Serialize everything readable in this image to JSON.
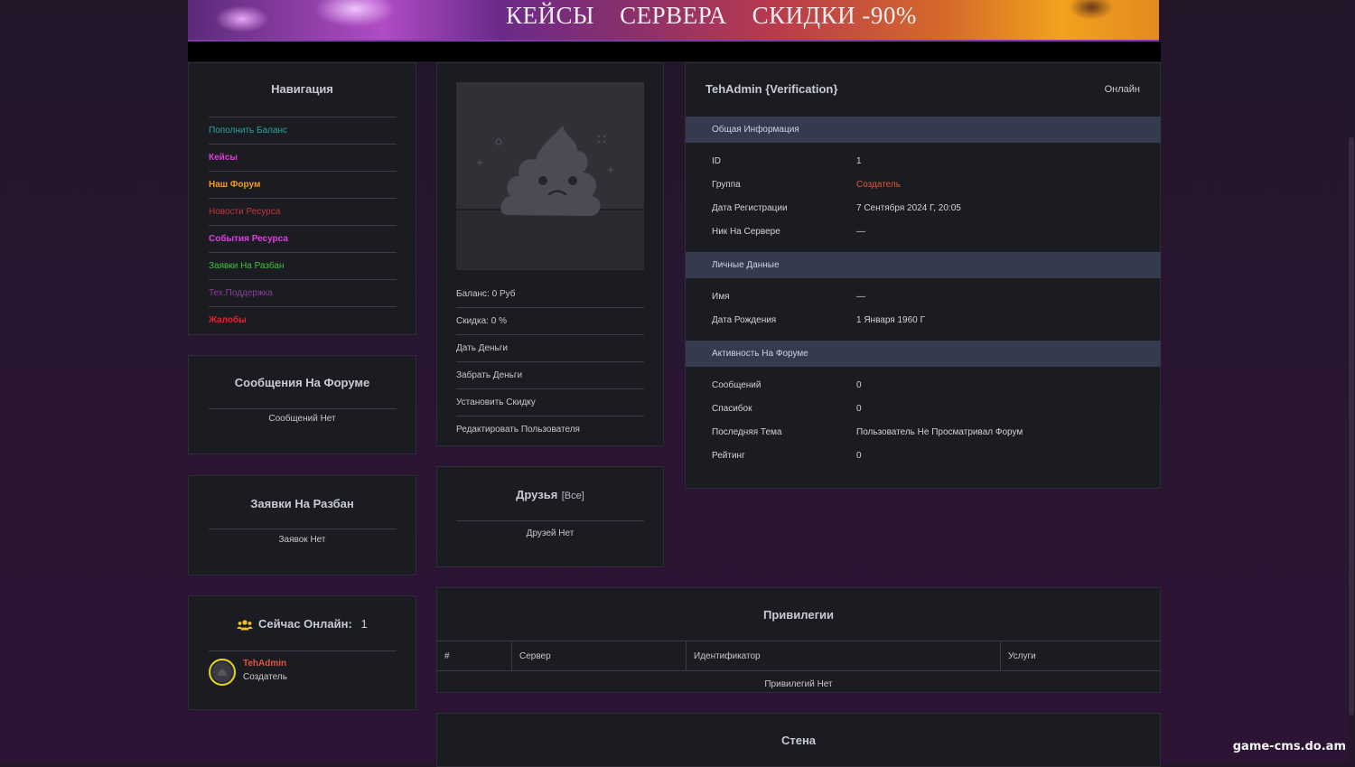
{
  "banner": {
    "items": [
      "КЕЙСЫ",
      "СЕРВЕРА",
      "СКИДКИ -90%"
    ]
  },
  "colors": {
    "accent_bar": "#353a4f",
    "panel_bg": "#1b1c22",
    "page_bg": "#231629"
  },
  "navigation": {
    "title": "Навигация",
    "items": [
      {
        "label": "Пополнить Баланс",
        "color": "#2ea3a3"
      },
      {
        "label": "Кейсы",
        "color": "#e03bd8"
      },
      {
        "label": "Наш Форум",
        "color": "#f39a1a"
      },
      {
        "label": "Новости Ресурса",
        "color": "#c2343d"
      },
      {
        "label": "События Ресурса",
        "color": "#e33be3"
      },
      {
        "label": "Заявки На Разбан",
        "color": "#3cc23c"
      },
      {
        "label": "Тех.Поддержка",
        "color": "#8a3e9c"
      },
      {
        "label": "Жалобы",
        "color": "#e0232d"
      }
    ]
  },
  "forum_messages": {
    "title": "Сообщения На Форуме",
    "empty": "Сообщений Нет"
  },
  "unban_requests": {
    "title": "Заявки На Разбан",
    "empty": "Заявок Нет"
  },
  "online": {
    "icon": "users-icon",
    "title": "Сейчас Онлайн:",
    "count": "1",
    "user": {
      "name": "TehAdmin",
      "role": "Создатель",
      "name_color": "#e0553a"
    }
  },
  "profile": {
    "avatar_icon": "poop-icon",
    "stats": [
      "Баланс: 0 Руб",
      "Скидка: 0 %",
      "Дать Деньги",
      "Забрать Деньги",
      "Установить Скидку",
      "Редактировать Пользователя"
    ]
  },
  "friends": {
    "title": "Друзья",
    "all_link": "[Все]",
    "empty": "Друзей Нет"
  },
  "user": {
    "name": "TehAdmin {Verification}",
    "status": "Онлайн",
    "general": {
      "title": "Общая Информация",
      "rows": [
        {
          "label": "ID",
          "value": "1"
        },
        {
          "label": "Группа",
          "value": "Создатель"
        },
        {
          "label": "Дата Регистрации",
          "value": "7 Сентября 2024 Г, 20:05"
        },
        {
          "label": "Ник На Сервере",
          "value": "—"
        }
      ]
    },
    "personal": {
      "title": "Личные Данные",
      "rows": [
        {
          "label": "Имя",
          "value": "—"
        },
        {
          "label": "Дата Рождения",
          "value": "1 Января 1960 Г"
        }
      ]
    },
    "forum": {
      "title": "Активность На Форуме",
      "rows": [
        {
          "label": "Сообщений",
          "value": "0"
        },
        {
          "label": "Спасибок",
          "value": "0"
        },
        {
          "label": "Последняя Тема",
          "value": "Пользователь Не Просматривал Форум"
        },
        {
          "label": "Рейтинг",
          "value": "0"
        }
      ]
    },
    "group_color": "#e0553a"
  },
  "privileges": {
    "title": "Привилегии",
    "columns": [
      "#",
      "Сервер",
      "Идентификатор",
      "Услуги"
    ],
    "empty": "Привилегий Нет"
  },
  "wall": {
    "title": "Стена"
  },
  "watermark": "game-cms.do.am"
}
